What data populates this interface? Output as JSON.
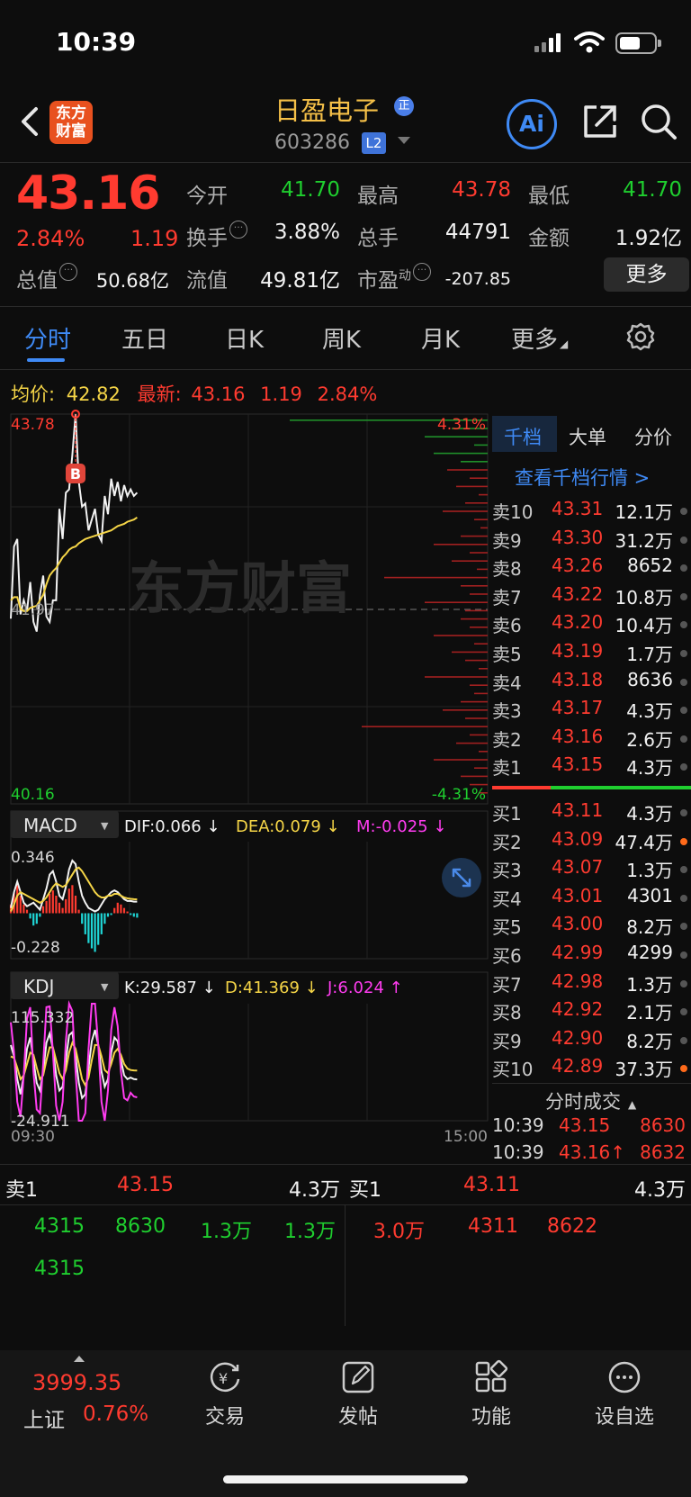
{
  "status_bar": {
    "time": "10:39"
  },
  "header": {
    "logo_text_1": "东方",
    "logo_text_2": "财富",
    "stock_name": "日盈电子",
    "badge": "正",
    "stock_code": "603286",
    "level": "L2",
    "ai_label": "Ai"
  },
  "quote": {
    "price": "43.16",
    "pct": "2.84%",
    "chg": "1.19",
    "rows": [
      [
        {
          "label": "今开",
          "value": "41.70",
          "color": "green"
        },
        {
          "label": "最高",
          "value": "43.78",
          "color": "red"
        },
        {
          "label": "最低",
          "value": "41.70",
          "color": "green"
        }
      ],
      [
        {
          "label": "换手",
          "value": "3.88%",
          "color": "white"
        },
        {
          "label": "总手",
          "value": "44791",
          "color": "white"
        },
        {
          "label": "金额",
          "value": "1.92亿",
          "color": "white"
        }
      ]
    ],
    "total_value_label": "总值",
    "total_value": "50.68亿",
    "float_label": "流值",
    "float_value": "49.81亿",
    "pe_label": "市盈",
    "pe_sup": "动",
    "pe_value": "-207.85",
    "more": "更多"
  },
  "tabs": [
    "分时",
    "五日",
    "日K",
    "周K",
    "月K",
    "更多"
  ],
  "avg": {
    "avg_label": "均价:",
    "avg_value": "42.82",
    "latest_label": "最新:",
    "latest_value": "43.16",
    "latest_chg": "1.19",
    "latest_pct": "2.84%"
  },
  "chart_data": [
    {
      "type": "line",
      "title": "分时",
      "ylim": [
        40.16,
        43.78
      ],
      "y_top_label": "43.78",
      "y_bottom_label": "40.16",
      "y_mid_label": "41.97",
      "pct_top_label": "4.31%",
      "pct_bottom_label": "-4.31%",
      "x_start_label": "09:30",
      "x_end_label": "15:00",
      "marker": "B",
      "watermark": "东方财富",
      "series": [
        {
          "values": [
            41.88,
            42.55,
            42.62,
            41.92,
            42.05,
            41.95,
            42.22,
            41.85,
            41.76,
            42.1,
            42.28,
            41.9,
            41.85,
            42.05,
            42.05,
            42.9,
            42.62,
            43.05,
            43.08,
            43.4,
            43.78,
            43.15,
            42.92,
            42.95,
            42.7,
            42.8,
            42.9,
            42.66,
            42.6,
            43.02,
            42.85,
            43.18,
            43.02,
            43.15,
            42.97,
            43.12,
            43.02,
            43.08,
            43.02,
            43.05
          ]
        },
        {
          "values": [
            42.05,
            42.08,
            42.08,
            41.97,
            41.95,
            41.95,
            41.98,
            41.99,
            42.0,
            42.05,
            42.1,
            42.2,
            42.28,
            42.32,
            42.35,
            42.4,
            42.45,
            42.48,
            42.52,
            42.54,
            42.55,
            42.58,
            42.6,
            42.62,
            42.63,
            42.64,
            42.65,
            42.66,
            42.67,
            42.68,
            42.69,
            42.7,
            42.72,
            42.74,
            42.75,
            42.76,
            42.78,
            42.79,
            42.8,
            42.82
          ]
        }
      ]
    },
    {
      "type": "bar",
      "title": "MACD",
      "dif_label": "DIF:0.066 ↓",
      "dea_label": "DEA:0.079 ↓",
      "m_label": "M:-0.025 ↓",
      "ylim": [
        -0.228,
        0.346
      ],
      "y_top_label": "0.346",
      "y_bottom_label": "-0.228",
      "values": [
        0.05,
        0.12,
        0.16,
        0.1,
        0.05,
        0.02,
        -0.03,
        -0.07,
        -0.06,
        -0.02,
        0.04,
        0.07,
        0.11,
        0.13,
        0.1,
        0.06,
        0.03,
        0.08,
        0.14,
        0.16,
        0.1,
        0.02,
        -0.06,
        -0.12,
        -0.17,
        -0.2,
        -0.22,
        -0.18,
        -0.12,
        -0.06,
        -0.02,
        -0.01,
        0.03,
        0.06,
        0.05,
        0.03,
        0.01,
        -0.01,
        -0.02,
        -0.025
      ],
      "series": [
        {
          "values": [
            0.03,
            0.12,
            0.18,
            0.12,
            0.06,
            0.04,
            0.05,
            0.06,
            0.04,
            0.02,
            0.08,
            0.14,
            0.22,
            0.24,
            0.18,
            0.1,
            0.08,
            0.15,
            0.25,
            0.3,
            0.28,
            0.18,
            0.1,
            0.06,
            0.03,
            0.02,
            0.01,
            0.02,
            0.05,
            0.08,
            0.1,
            0.12,
            0.13,
            0.12,
            0.1,
            0.08,
            0.07,
            0.07,
            0.066,
            0.066
          ]
        },
        {
          "values": [
            0.01,
            0.05,
            0.1,
            0.12,
            0.11,
            0.1,
            0.09,
            0.08,
            0.07,
            0.06,
            0.07,
            0.09,
            0.12,
            0.15,
            0.17,
            0.16,
            0.15,
            0.16,
            0.19,
            0.22,
            0.25,
            0.26,
            0.24,
            0.21,
            0.18,
            0.15,
            0.12,
            0.1,
            0.09,
            0.09,
            0.1,
            0.1,
            0.11,
            0.11,
            0.1,
            0.09,
            0.085,
            0.082,
            0.08,
            0.079
          ]
        }
      ]
    },
    {
      "type": "line",
      "title": "KDJ",
      "k_label": "K:29.587 ↓",
      "d_label": "D:41.369 ↓",
      "j_label": "J:6.024 ↑",
      "ylim": [
        -24.911,
        115.332
      ],
      "y_top_label": "115.332",
      "y_bottom_label": "-24.911",
      "series": [
        {
          "values": [
            75,
            60,
            30,
            10,
            35,
            70,
            85,
            55,
            25,
            15,
            40,
            78,
            90,
            70,
            35,
            15,
            20,
            55,
            88,
            92,
            60,
            25,
            5,
            10,
            45,
            80,
            95,
            75,
            40,
            20,
            30,
            65,
            85,
            80,
            55,
            35,
            30,
            32,
            30,
            29.587
          ]
        },
        {
          "values": [
            60,
            58,
            45,
            30,
            35,
            50,
            65,
            62,
            45,
            30,
            35,
            55,
            72,
            72,
            55,
            38,
            30,
            42,
            65,
            78,
            70,
            50,
            30,
            22,
            32,
            55,
            75,
            75,
            60,
            42,
            38,
            50,
            65,
            70,
            62,
            50,
            44,
            42,
            41.5,
            41.369
          ]
        },
        {
          "values": [
            105,
            65,
            0,
            -20,
            35,
            110,
            125,
            40,
            -10,
            -15,
            50,
            125,
            126,
            66,
            -5,
            -30,
            0,
            80,
            134,
            120,
            40,
            -25,
            -45,
            -15,
            70,
            130,
            135,
            75,
            0,
            -25,
            15,
            95,
            125,
            100,
            40,
            5,
            2,
            12,
            7,
            6.024
          ]
        }
      ]
    }
  ],
  "macd_title": "MACD",
  "kdj_title": "KDJ",
  "orderbook": {
    "tabs": [
      "千档",
      "大单",
      "分价"
    ],
    "link": "查看千档行情 >",
    "asks": [
      {
        "label": "卖10",
        "price": "43.31",
        "vol": "12.1万"
      },
      {
        "label": "卖9",
        "price": "43.30",
        "vol": "31.2万"
      },
      {
        "label": "卖8",
        "price": "43.26",
        "vol": "8652"
      },
      {
        "label": "卖7",
        "price": "43.22",
        "vol": "10.8万"
      },
      {
        "label": "卖6",
        "price": "43.20",
        "vol": "10.4万"
      },
      {
        "label": "卖5",
        "price": "43.19",
        "vol": "1.7万"
      },
      {
        "label": "卖4",
        "price": "43.18",
        "vol": "8636"
      },
      {
        "label": "卖3",
        "price": "43.17",
        "vol": "4.3万"
      },
      {
        "label": "卖2",
        "price": "43.16",
        "vol": "2.6万"
      },
      {
        "label": "卖1",
        "price": "43.15",
        "vol": "4.3万"
      }
    ],
    "bids": [
      {
        "label": "买1",
        "price": "43.11",
        "vol": "4.3万",
        "dot": "grey"
      },
      {
        "label": "买2",
        "price": "43.09",
        "vol": "47.4万",
        "dot": "orange"
      },
      {
        "label": "买3",
        "price": "43.07",
        "vol": "1.3万",
        "dot": "grey"
      },
      {
        "label": "买4",
        "price": "43.01",
        "vol": "4301",
        "dot": "grey"
      },
      {
        "label": "买5",
        "price": "43.00",
        "vol": "8.2万",
        "dot": "grey"
      },
      {
        "label": "买6",
        "price": "42.99",
        "vol": "4299",
        "dot": "grey"
      },
      {
        "label": "买7",
        "price": "42.98",
        "vol": "1.3万",
        "dot": "grey"
      },
      {
        "label": "买8",
        "price": "42.92",
        "vol": "2.1万",
        "dot": "grey"
      },
      {
        "label": "买9",
        "price": "42.90",
        "vol": "8.2万",
        "dot": "grey"
      },
      {
        "label": "买10",
        "price": "42.89",
        "vol": "37.3万",
        "dot": "orange"
      }
    ],
    "trades_title": "分时成交",
    "trades": [
      {
        "time": "10:39",
        "price": "43.15",
        "vol": "8630"
      },
      {
        "time": "10:39",
        "price": "43.16↑",
        "vol": "8632"
      }
    ]
  },
  "bottom_panel": {
    "sell_label": "卖1",
    "sell_price": "43.15",
    "sell_vol": "4.3万",
    "buy_label": "买1",
    "buy_price": "43.11",
    "buy_vol": "4.3万",
    "sell_queue": [
      "4315",
      "8630",
      "1.3万",
      "1.3万"
    ],
    "sell_queue2": [
      "4315"
    ],
    "buy_queue": [
      "3.0万",
      "4311",
      "8622"
    ]
  },
  "bottom_nav": {
    "index_value": "3999.35",
    "index_name": "上证",
    "index_pct": "0.76%",
    "items": [
      "交易",
      "发帖",
      "功能",
      "设自选"
    ]
  }
}
